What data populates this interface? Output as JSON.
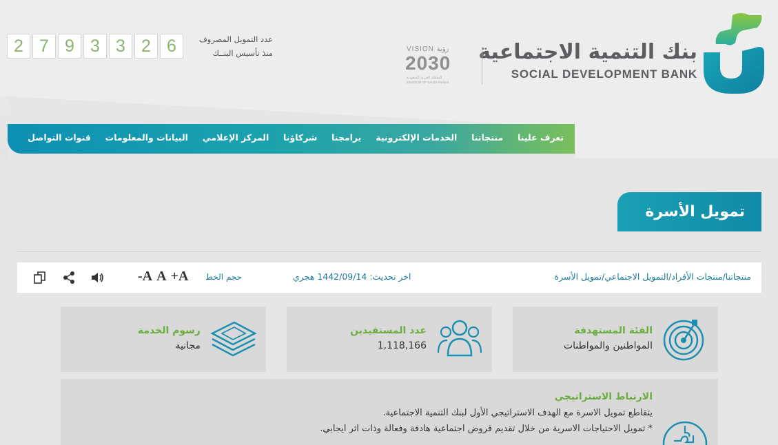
{
  "brand": {
    "name_ar": "بنك التنمية الاجتماعية",
    "name_en": "SOCIAL DEVELOPMENT BANK",
    "colors": {
      "teal": "#1aa0b5",
      "green": "#7bbf5a",
      "gray": "#5b5d60"
    }
  },
  "vision": {
    "top": "VISION رؤية",
    "number": "2030",
    "sub_ar": "المملكة العربية السعودية",
    "sub_en": "KINGDOM OF SAUDI ARABIA"
  },
  "counter": {
    "label_line1": "عدد التمويل المصروف",
    "label_line2": "منذ تأسيس البنــك",
    "digits": [
      "2",
      "7",
      "9",
      "3",
      "3",
      "2",
      "6"
    ]
  },
  "nav": {
    "items": [
      {
        "label": "تعرف علينا"
      },
      {
        "label": "منتجاتنا"
      },
      {
        "label": "الخدمات الإلكترونية"
      },
      {
        "label": "برامجنا"
      },
      {
        "label": "شركاؤنا"
      },
      {
        "label": "المركز الإعلامي"
      },
      {
        "label": "البيانات والمعلومات"
      },
      {
        "label": "قنوات التواصل"
      }
    ]
  },
  "page": {
    "title": "تمويل الأسرة"
  },
  "toolbar": {
    "breadcrumb": "منتجاتنا/منتجات الأفراد/التمويل الاجتماعي/تمويل الأسرة",
    "last_update": "اخر تحديث: 1442/09/14 هجري",
    "font_size_label": "حجم الخط",
    "font_increase": "A+",
    "font_normal": "A",
    "font_decrease": "A-",
    "icons": [
      "speaker-icon",
      "share-icon",
      "copy-icon"
    ]
  },
  "cards": [
    {
      "title": "الفئة المستهدفة",
      "value": "المواطنين والمواطنات",
      "icon": "target-icon"
    },
    {
      "title": "عدد المستفيدين",
      "value": "1,118,166",
      "icon": "users-icon"
    },
    {
      "title": "رسوم الخدمة",
      "value": "مجانية",
      "icon": "money-stack-icon"
    }
  ],
  "strategic": {
    "title": "الارتباط الاستراتيجي",
    "line1": "يتقاطع تمويل الاسرة مع الهدف الاستراتيجي الأول لبنك التنمية الاجتماعية.",
    "line2": "* تمويل الاحتياجات الاسرية من خلال تقديم قروض اجتماعية هادفة وفعالة وذات اثر ايجابي.",
    "icon": "puzzle-icon"
  }
}
